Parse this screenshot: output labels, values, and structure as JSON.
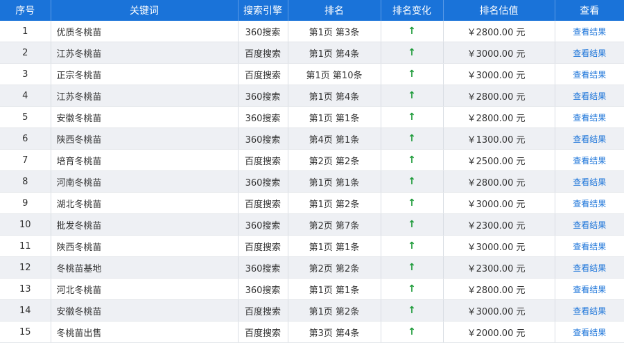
{
  "headers": {
    "index": "序号",
    "keyword": "关键词",
    "engine": "搜索引擎",
    "rank": "排名",
    "change": "排名变化",
    "estimate": "排名估值",
    "view": "查看"
  },
  "colors": {
    "header_bg": "#1a73d9",
    "stripe": "#eef0f4",
    "arrow_up": "#1e9b3a",
    "link": "#1a73d9"
  },
  "change_icon": "arrow-up-icon",
  "rows": [
    {
      "index": "1",
      "keyword": "优质冬桃苗",
      "engine": "360搜索",
      "rank": "第1页 第3条",
      "change": "↑",
      "estimate": "￥2800.00 元",
      "view": "查看结果"
    },
    {
      "index": "2",
      "keyword": "江苏冬桃苗",
      "engine": "百度搜索",
      "rank": "第1页 第4条",
      "change": "↑",
      "estimate": "￥3000.00 元",
      "view": "查看结果"
    },
    {
      "index": "3",
      "keyword": "正宗冬桃苗",
      "engine": "百度搜索",
      "rank": "第1页 第10条",
      "change": "↑",
      "estimate": "￥3000.00 元",
      "view": "查看结果"
    },
    {
      "index": "4",
      "keyword": "江苏冬桃苗",
      "engine": "360搜索",
      "rank": "第1页 第4条",
      "change": "↑",
      "estimate": "￥2800.00 元",
      "view": "查看结果"
    },
    {
      "index": "5",
      "keyword": "安徽冬桃苗",
      "engine": "360搜索",
      "rank": "第1页 第1条",
      "change": "↑",
      "estimate": "￥2800.00 元",
      "view": "查看结果"
    },
    {
      "index": "6",
      "keyword": "陕西冬桃苗",
      "engine": "360搜索",
      "rank": "第4页 第1条",
      "change": "↑",
      "estimate": "￥1300.00 元",
      "view": "查看结果"
    },
    {
      "index": "7",
      "keyword": "培育冬桃苗",
      "engine": "百度搜索",
      "rank": "第2页 第2条",
      "change": "↑",
      "estimate": "￥2500.00 元",
      "view": "查看结果"
    },
    {
      "index": "8",
      "keyword": "河南冬桃苗",
      "engine": "360搜索",
      "rank": "第1页 第1条",
      "change": "↑",
      "estimate": "￥2800.00 元",
      "view": "查看结果"
    },
    {
      "index": "9",
      "keyword": "湖北冬桃苗",
      "engine": "百度搜索",
      "rank": "第1页 第2条",
      "change": "↑",
      "estimate": "￥3000.00 元",
      "view": "查看结果"
    },
    {
      "index": "10",
      "keyword": "批发冬桃苗",
      "engine": "360搜索",
      "rank": "第2页 第7条",
      "change": "↑",
      "estimate": "￥2300.00 元",
      "view": "查看结果"
    },
    {
      "index": "11",
      "keyword": "陕西冬桃苗",
      "engine": "百度搜索",
      "rank": "第1页 第1条",
      "change": "↑",
      "estimate": "￥3000.00 元",
      "view": "查看结果"
    },
    {
      "index": "12",
      "keyword": "冬桃苗基地",
      "engine": "360搜索",
      "rank": "第2页 第2条",
      "change": "↑",
      "estimate": "￥2300.00 元",
      "view": "查看结果"
    },
    {
      "index": "13",
      "keyword": "河北冬桃苗",
      "engine": "360搜索",
      "rank": "第1页 第1条",
      "change": "↑",
      "estimate": "￥2800.00 元",
      "view": "查看结果"
    },
    {
      "index": "14",
      "keyword": "安徽冬桃苗",
      "engine": "百度搜索",
      "rank": "第1页 第2条",
      "change": "↑",
      "estimate": "￥3000.00 元",
      "view": "查看结果"
    },
    {
      "index": "15",
      "keyword": "冬桃苗出售",
      "engine": "百度搜索",
      "rank": "第3页 第4条",
      "change": "↑",
      "estimate": "￥2000.00 元",
      "view": "查看结果"
    }
  ]
}
